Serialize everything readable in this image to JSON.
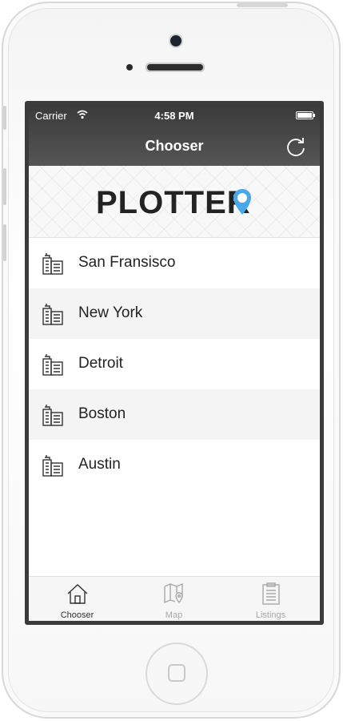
{
  "status_bar": {
    "carrier": "Carrier",
    "time": "4:58 PM",
    "battery_level": 1.0
  },
  "navbar": {
    "title": "Chooser"
  },
  "header": {
    "logo_text": "PLOTTER"
  },
  "cities": [
    {
      "name": "San Fransisco"
    },
    {
      "name": "New York"
    },
    {
      "name": "Detroit"
    },
    {
      "name": "Boston"
    },
    {
      "name": "Austin"
    }
  ],
  "tabs": [
    {
      "label": "Chooser",
      "icon": "home-icon",
      "active": true
    },
    {
      "label": "Map",
      "icon": "map-icon",
      "active": false
    },
    {
      "label": "Listings",
      "icon": "clipboard-icon",
      "active": false
    }
  ],
  "colors": {
    "accent": "#4aa8e8",
    "navbar": "#4a4a4a",
    "active_tab": "#333333",
    "inactive_tab": "#a8a8a8"
  }
}
